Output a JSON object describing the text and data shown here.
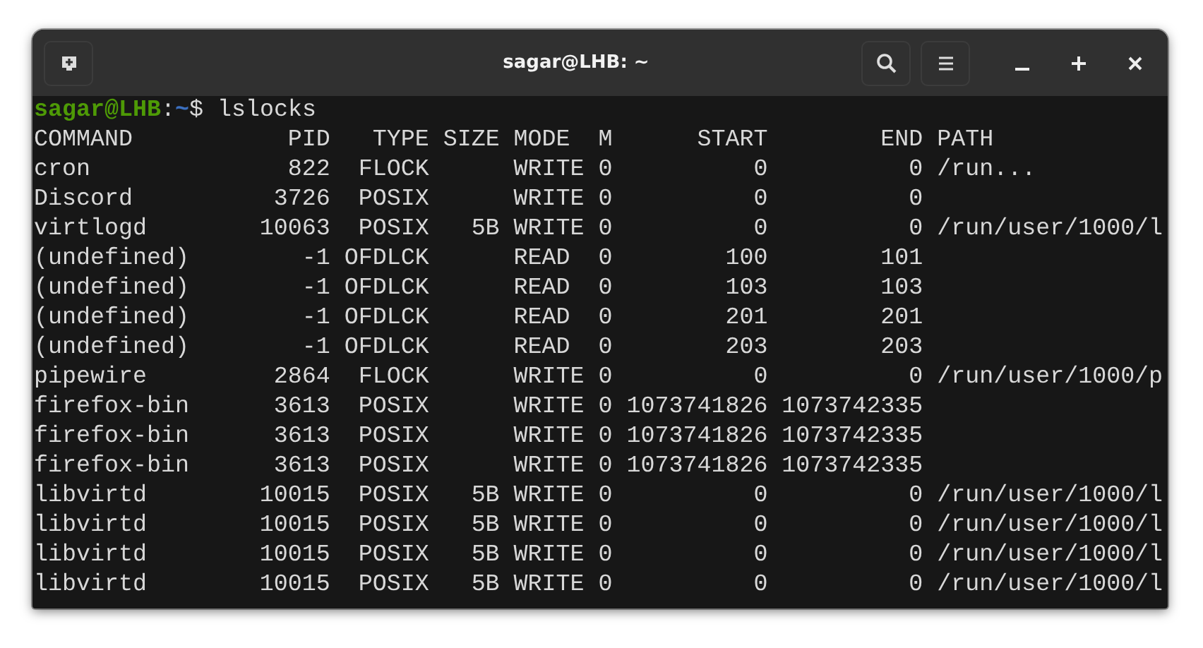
{
  "window": {
    "title": "sagar@LHB: ~"
  },
  "prompt": {
    "user_host": "sagar@LHB",
    "separator": ":",
    "cwd": "~",
    "symbol": "$",
    "command": "lslocks"
  },
  "table": {
    "columns": [
      "COMMAND",
      "PID",
      "TYPE",
      "SIZE",
      "MODE",
      "M",
      "START",
      "END",
      "PATH"
    ],
    "rows": [
      [
        "cron",
        "822",
        "FLOCK",
        null,
        "WRITE",
        "0",
        "0",
        "0",
        "/run..."
      ],
      [
        "Discord",
        "3726",
        "POSIX",
        null,
        "WRITE",
        "0",
        "0",
        "0",
        null
      ],
      [
        "virtlogd",
        "10063",
        "POSIX",
        "5B",
        "WRITE",
        "0",
        "0",
        "0",
        "/run/user/1000/l"
      ],
      [
        "(undefined)",
        "-1",
        "OFDLCK",
        null,
        "READ",
        "0",
        "100",
        "101",
        null
      ],
      [
        "(undefined)",
        "-1",
        "OFDLCK",
        null,
        "READ",
        "0",
        "103",
        "103",
        null
      ],
      [
        "(undefined)",
        "-1",
        "OFDLCK",
        null,
        "READ",
        "0",
        "201",
        "201",
        null
      ],
      [
        "(undefined)",
        "-1",
        "OFDLCK",
        null,
        "READ",
        "0",
        "203",
        "203",
        null
      ],
      [
        "pipewire",
        "2864",
        "FLOCK",
        null,
        "WRITE",
        "0",
        "0",
        "0",
        "/run/user/1000/p"
      ],
      [
        "firefox-bin",
        "3613",
        "POSIX",
        null,
        "WRITE",
        "0",
        "1073741826",
        "1073742335",
        null
      ],
      [
        "firefox-bin",
        "3613",
        "POSIX",
        null,
        "WRITE",
        "0",
        "1073741826",
        "1073742335",
        null
      ],
      [
        "firefox-bin",
        "3613",
        "POSIX",
        null,
        "WRITE",
        "0",
        "1073741826",
        "1073742335",
        null
      ],
      [
        "libvirtd",
        "10015",
        "POSIX",
        "5B",
        "WRITE",
        "0",
        "0",
        "0",
        "/run/user/1000/l"
      ],
      [
        "libvirtd",
        "10015",
        "POSIX",
        "5B",
        "WRITE",
        "0",
        "0",
        "0",
        "/run/user/1000/l"
      ],
      [
        "libvirtd",
        "10015",
        "POSIX",
        "5B",
        "WRITE",
        "0",
        "0",
        "0",
        "/run/user/1000/l"
      ],
      [
        "libvirtd",
        "10015",
        "POSIX",
        "5B",
        "WRITE",
        "0",
        "0",
        "0",
        "/run/user/1000/l"
      ]
    ]
  }
}
